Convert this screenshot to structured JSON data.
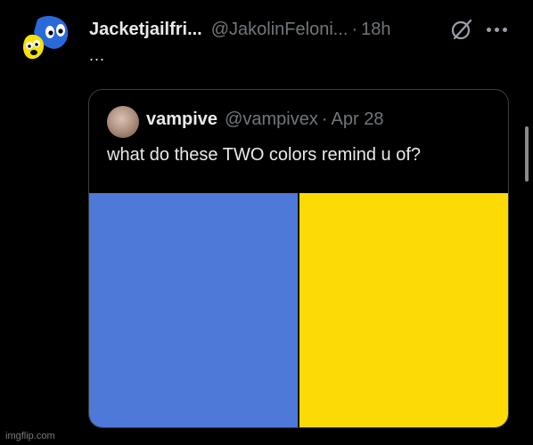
{
  "colors": {
    "background": "#000000",
    "left_panel": "#4F79D8",
    "right_panel": "#FCDB04",
    "muted_text": "#71767b"
  },
  "tweet": {
    "display_name": "Jacketjailfri...",
    "handle": "@JakolinFeloni...",
    "separator": "·",
    "time": "18h",
    "text": "...",
    "icons": [
      "avatar-cartoon",
      "grok-icon",
      "more-options-icon"
    ]
  },
  "quote": {
    "display_name": "vampive",
    "handle": "@vampivex",
    "separator": "·",
    "date": "Apr 28",
    "text": "what do these TWO colors remind u of?",
    "media": [
      {
        "color": "#4F79D8"
      },
      {
        "color": "#FCDB04"
      }
    ]
  },
  "watermark": "imgflip.com"
}
